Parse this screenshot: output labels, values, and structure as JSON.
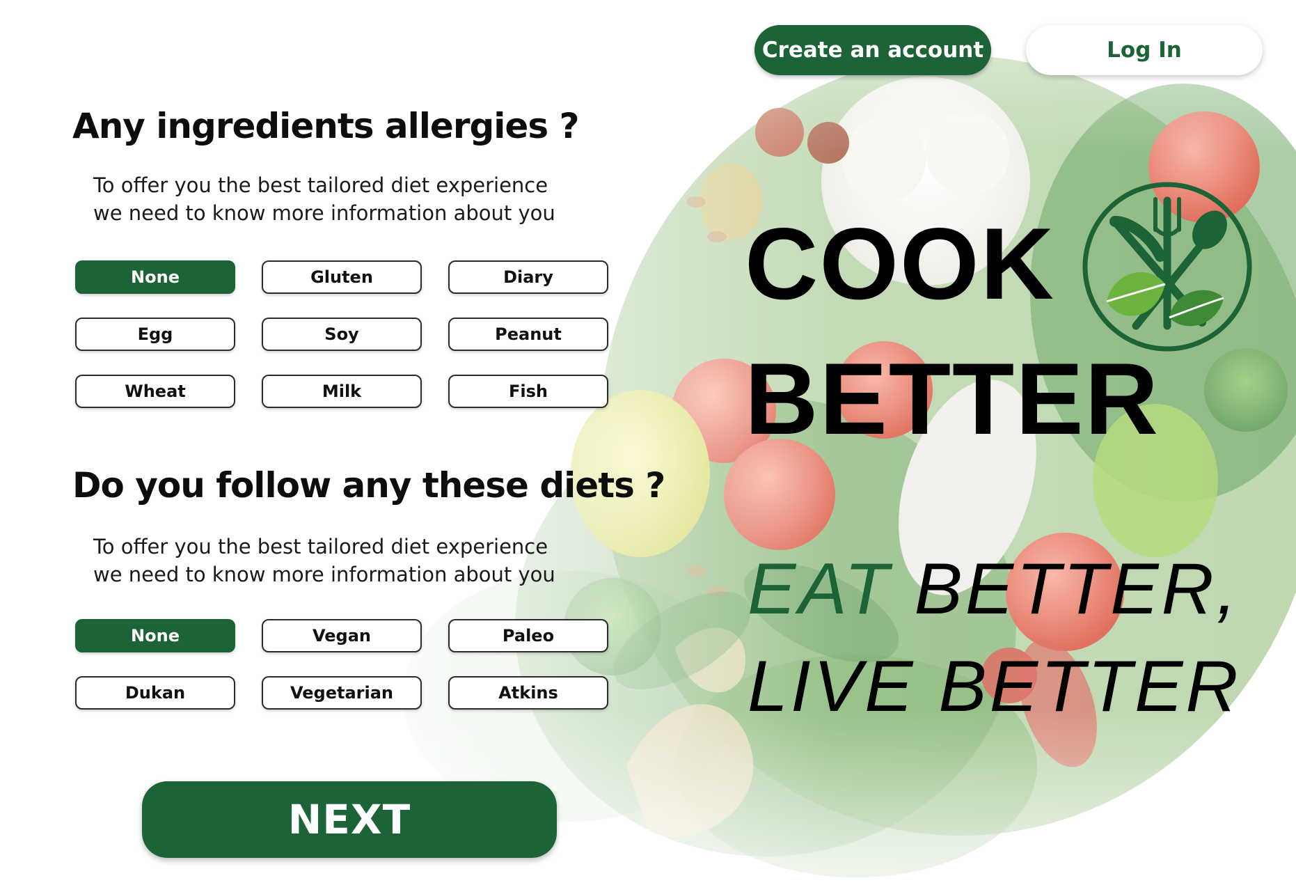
{
  "header": {
    "create_account": "Create an account",
    "login": "Log In"
  },
  "allergies": {
    "title": "Any ingredients allergies ?",
    "subtitle_line1": "To offer you the best tailored diet experience",
    "subtitle_line2": "we need to know more information about you",
    "options": [
      "None",
      "Gluten",
      "Diary",
      "Egg",
      "Soy",
      "Peanut",
      "Wheat",
      "Milk",
      "Fish"
    ],
    "selected": "None"
  },
  "diets": {
    "title": "Do you follow any these diets ?",
    "subtitle_line1": "To offer you the best tailored diet experience",
    "subtitle_line2": "we need to know more information about you",
    "options": [
      "None",
      "Vegan",
      "Paleo",
      "Dukan",
      "Vegetarian",
      "Atkins"
    ],
    "selected": "None"
  },
  "next_label": "NEXT",
  "brand": {
    "line1": "COOK",
    "line2": "BETTER",
    "logo_icon": "fork-knife-spoon-leaf-icon"
  },
  "tagline": {
    "line1_green": "EAT",
    "line1_black": " BETTER,",
    "line2": "LIVE BETTER"
  },
  "colors": {
    "accent": "#1d6338",
    "text": "#0b0b0b",
    "background": "#ffffff"
  }
}
